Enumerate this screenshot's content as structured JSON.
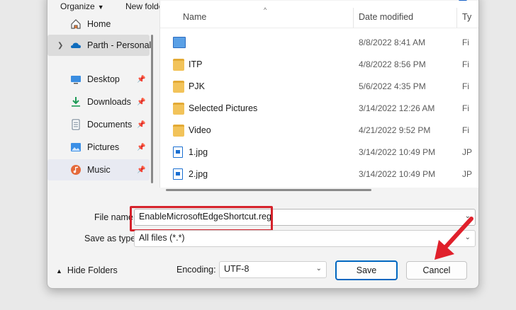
{
  "toolbar": {
    "organize": "Organize",
    "new_folder": "New folder",
    "help": "?"
  },
  "nav": {
    "items": [
      {
        "label": "Home",
        "icon": "home-icon"
      },
      {
        "label": "Parth - Personal",
        "icon": "onedrive-cloud-icon"
      },
      {
        "label": "Desktop",
        "icon": "desktop-icon"
      },
      {
        "label": "Downloads",
        "icon": "downloads-icon"
      },
      {
        "label": "Documents",
        "icon": "documents-icon"
      },
      {
        "label": "Pictures",
        "icon": "pictures-icon"
      },
      {
        "label": "Music",
        "icon": "music-icon"
      }
    ]
  },
  "columns": {
    "name": "Name",
    "date": "Date modified",
    "type": "Ty"
  },
  "files": [
    {
      "name": "",
      "date": "8/8/2022 8:41 AM",
      "type": "Fi",
      "kind": "reg"
    },
    {
      "name": "ITP",
      "date": "4/8/2022 8:56 PM",
      "type": "Fi",
      "kind": "folder"
    },
    {
      "name": "PJK",
      "date": "5/6/2022 4:35 PM",
      "type": "Fi",
      "kind": "folder"
    },
    {
      "name": "Selected Pictures",
      "date": "3/14/2022 12:26 AM",
      "type": "Fi",
      "kind": "folder"
    },
    {
      "name": "Video",
      "date": "4/21/2022 9:52 PM",
      "type": "Fi",
      "kind": "folder"
    },
    {
      "name": "1.jpg",
      "date": "3/14/2022 10:49 PM",
      "type": "JP",
      "kind": "jpg"
    },
    {
      "name": "2.jpg",
      "date": "3/14/2022 10:49 PM",
      "type": "JP",
      "kind": "jpg"
    }
  ],
  "form": {
    "file_name_label": "File name:",
    "file_name_value": "EnableMicrosoftEdgeShortcut.reg",
    "save_type_label": "Save as type:",
    "save_type_value": "All files  (*.*)",
    "hide_folders": "Hide Folders",
    "encoding_label": "Encoding:",
    "encoding_value": "UTF-8",
    "save": "Save",
    "cancel": "Cancel"
  },
  "colors": {
    "highlight": "#d5222b",
    "accent": "#0067c0",
    "folder": "#f2c35a"
  }
}
